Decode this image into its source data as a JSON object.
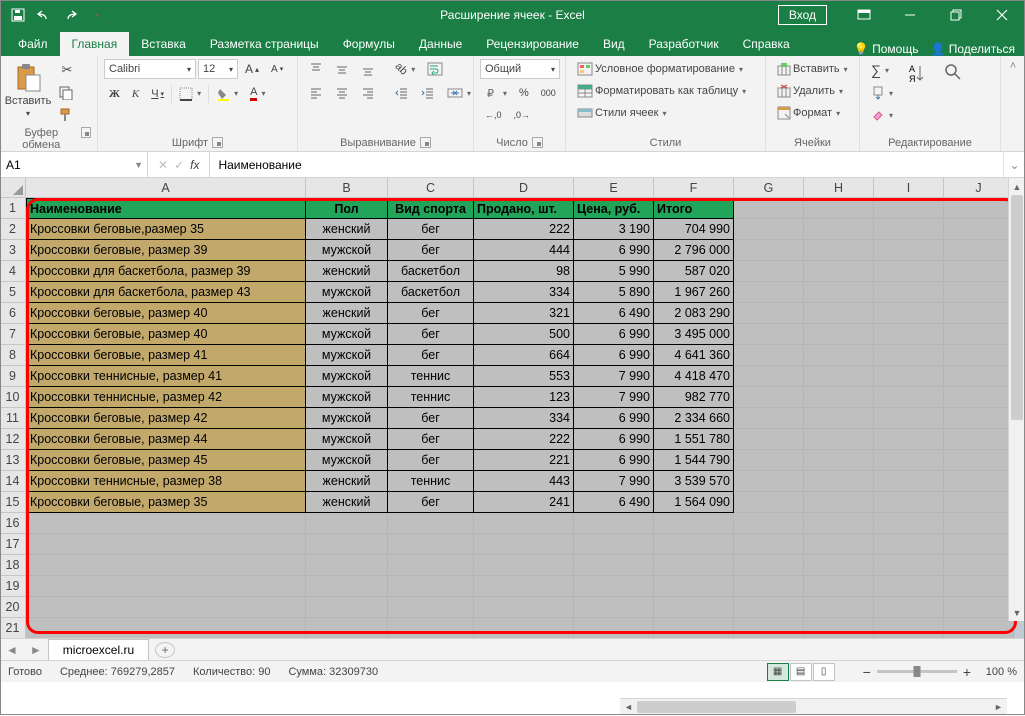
{
  "titlebar": {
    "title": "Расширение ячеек - Excel",
    "signin": "Вход"
  },
  "tabs": {
    "file": "Файл",
    "home": "Главная",
    "insert": "Вставка",
    "layout": "Разметка страницы",
    "formulas": "Формулы",
    "data": "Данные",
    "review": "Рецензирование",
    "view": "Вид",
    "developer": "Разработчик",
    "help": "Справка",
    "assist": "Помощь",
    "share": "Поделиться"
  },
  "ribbon": {
    "clipboard": {
      "paste": "Вставить",
      "title": "Буфер обмена"
    },
    "font": {
      "name": "Calibri",
      "size": "12",
      "title": "Шрифт"
    },
    "align": {
      "title": "Выравнивание"
    },
    "number": {
      "format": "Общий",
      "title": "Число"
    },
    "styles": {
      "cond": "Условное форматирование",
      "table": "Форматировать как таблицу",
      "cell": "Стили ячеек",
      "title": "Стили"
    },
    "cells": {
      "insert": "Вставить",
      "delete": "Удалить",
      "format": "Формат",
      "title": "Ячейки"
    },
    "editing": {
      "title": "Редактирование"
    }
  },
  "namebox": "A1",
  "formula": "Наименование",
  "sheetname": "microexcel.ru",
  "status": {
    "ready": "Готово",
    "avg_label": "Среднее:",
    "avg": "769279,2857",
    "count_label": "Количество:",
    "count": "90",
    "sum_label": "Сумма:",
    "sum": "32309730",
    "zoom": "100 %"
  },
  "columns": [
    "A",
    "B",
    "C",
    "D",
    "E",
    "F",
    "G",
    "H",
    "I",
    "J"
  ],
  "headers": [
    "Наименование",
    "Пол",
    "Вид спорта",
    "Продано, шт.",
    "Цена, руб.",
    "Итого"
  ],
  "rows": [
    [
      "Кроссовки беговые,размер 35",
      "женский",
      "бег",
      "222",
      "3 190",
      "704 990"
    ],
    [
      "Кроссовки беговые, размер 39",
      "мужской",
      "бег",
      "444",
      "6 990",
      "2 796 000"
    ],
    [
      "Кроссовки для баскетбола, размер 39",
      "женский",
      "баскетбол",
      "98",
      "5 990",
      "587 020"
    ],
    [
      "Кроссовки для баскетбола, размер 43",
      "мужской",
      "баскетбол",
      "334",
      "5 890",
      "1 967 260"
    ],
    [
      "Кроссовки беговые, размер 40",
      "женский",
      "бег",
      "321",
      "6 490",
      "2 083 290"
    ],
    [
      "Кроссовки беговые, размер 40",
      "мужской",
      "бег",
      "500",
      "6 990",
      "3 495 000"
    ],
    [
      "Кроссовки беговые, размер 41",
      "мужской",
      "бег",
      "664",
      "6 990",
      "4 641 360"
    ],
    [
      "Кроссовки теннисные, размер 41",
      "мужской",
      "теннис",
      "553",
      "7 990",
      "4 418 470"
    ],
    [
      "Кроссовки теннисные, размер 42",
      "мужской",
      "теннис",
      "123",
      "7 990",
      "982 770"
    ],
    [
      "Кроссовки беговые, размер 42",
      "мужской",
      "бег",
      "334",
      "6 990",
      "2 334 660"
    ],
    [
      "Кроссовки беговые, размер 44",
      "мужской",
      "бег",
      "222",
      "6 990",
      "1 551 780"
    ],
    [
      "Кроссовки беговые, размер 45",
      "мужской",
      "бег",
      "221",
      "6 990",
      "1 544 790"
    ],
    [
      "Кроссовки теннисные, размер 38",
      "женский",
      "теннис",
      "443",
      "7 990",
      "3 539 570"
    ],
    [
      "Кроссовки беговые, размер 35",
      "женский",
      "бег",
      "241",
      "6 490",
      "1 564 090"
    ]
  ]
}
